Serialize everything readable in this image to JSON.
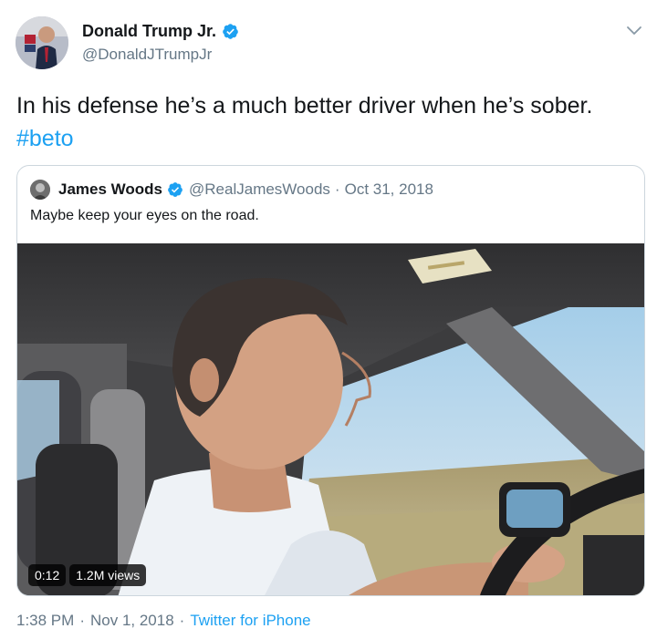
{
  "tweet": {
    "author": {
      "display_name": "Donald Trump Jr.",
      "handle": "@DonaldJTrumpJr",
      "verified_icon": "verified-badge-icon"
    },
    "text": "In his defense he’s a much better driver when he’s sober.",
    "hashtag": "#beto",
    "menu_icon": "chevron-down-icon",
    "footer": {
      "time": "1:38 PM",
      "date": "Nov 1, 2018",
      "source": "Twitter for iPhone",
      "separator": "·"
    }
  },
  "quote": {
    "author": {
      "display_name": "James Woods",
      "handle": "@RealJamesWoods",
      "verified_icon": "verified-badge-icon"
    },
    "separator": "·",
    "date": "Oct 31, 2018",
    "text": "Maybe keep your eyes on the road.",
    "video": {
      "duration": "0:12",
      "views": "1.2M views"
    }
  },
  "colors": {
    "link": "#1da1f2",
    "secondary_text": "#657786",
    "border": "#ccd6dd",
    "text": "#14171a"
  }
}
